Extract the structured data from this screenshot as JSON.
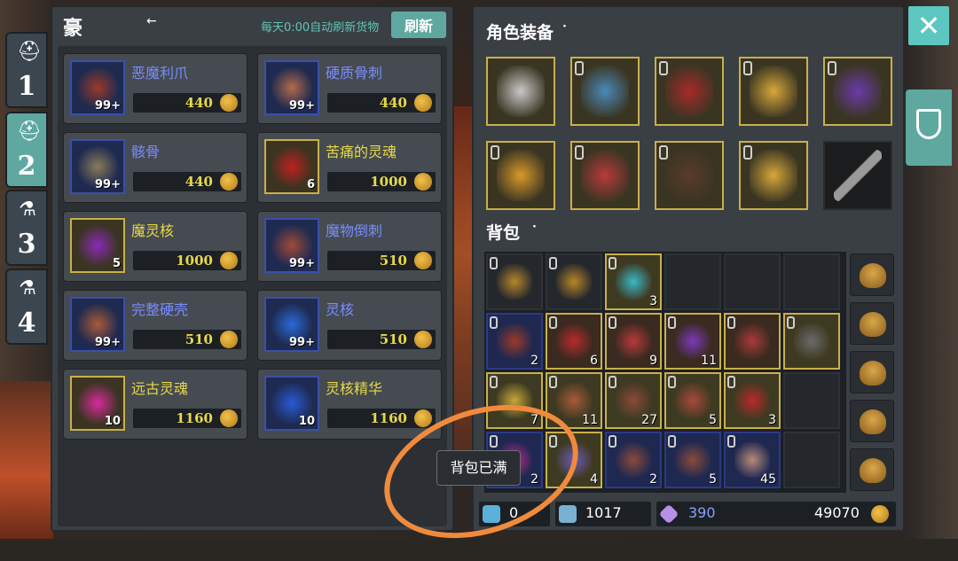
{
  "tabs": [
    {
      "num": "1",
      "icon": "helmet-icon",
      "active": false
    },
    {
      "num": "2",
      "icon": "helmet-icon",
      "active": true
    },
    {
      "num": "3",
      "icon": "potion-icon",
      "active": false
    },
    {
      "num": "4",
      "icon": "potion-icon",
      "active": false
    }
  ],
  "shop": {
    "title": "豪",
    "refresh_note": "每天0:00自动刷新货物",
    "refresh_label": "刷新",
    "items": [
      {
        "name": "恶魔利爪",
        "count": "99+",
        "price": "440",
        "name_color": "#7a8cff",
        "frame": "blue",
        "art": "#9a3a2a"
      },
      {
        "name": "硬质骨刺",
        "count": "99+",
        "price": "440",
        "name_color": "#7a8cff",
        "frame": "blue",
        "art": "#b26a4a"
      },
      {
        "name": "骸骨",
        "count": "99+",
        "price": "440",
        "name_color": "#7a8cff",
        "frame": "blue",
        "art": "#8a7a5a"
      },
      {
        "name": "苦痛的灵魂",
        "count": "6",
        "price": "1000",
        "name_color": "#e8d84a",
        "frame": "gold",
        "art": "#c02020"
      },
      {
        "name": "魔灵核",
        "count": "5",
        "price": "1000",
        "name_color": "#e8d84a",
        "frame": "gold",
        "art": "#8a2ab8"
      },
      {
        "name": "魔物倒刺",
        "count": "99+",
        "price": "510",
        "name_color": "#7a8cff",
        "frame": "blue",
        "art": "#a04a3a"
      },
      {
        "name": "完整硬壳",
        "count": "99+",
        "price": "510",
        "name_color": "#7a8cff",
        "frame": "blue",
        "art": "#a85a3a"
      },
      {
        "name": "灵核",
        "count": "99+",
        "price": "510",
        "name_color": "#7a8cff",
        "frame": "blue",
        "art": "#2a6ad8"
      },
      {
        "name": "远古灵魂",
        "count": "10",
        "price": "1160",
        "name_color": "#e8d84a",
        "frame": "gold",
        "art": "#d82a9a"
      },
      {
        "name": "灵核精华",
        "count": "10",
        "price": "1160",
        "name_color": "#e8d84a",
        "frame": "blue",
        "art": "#2a5ad8"
      }
    ]
  },
  "equip": {
    "title": "角色装备",
    "bag_title": "背包",
    "slots": [
      {
        "art": "#c8c8c8",
        "locked": false
      },
      {
        "art": "#4a8ab8",
        "locked": true
      },
      {
        "art": "#a82a2a",
        "locked": true
      },
      {
        "art": "#d8a83a",
        "locked": true
      },
      {
        "art": "#6a3aa8",
        "locked": true
      },
      {
        "art": "#d89a2a",
        "locked": true
      },
      {
        "art": "#b83a3a",
        "locked": true
      },
      {
        "art": "#5a3a2a",
        "locked": true
      },
      {
        "art": "#d8a83a",
        "locked": true
      },
      {
        "art": "#9a9a9a",
        "locked": false,
        "dark": true
      }
    ],
    "bag": [
      [
        "e:#b8862a:",
        "e:#b8862a:",
        "g:#3ab8c8:3",
        "e::",
        "e::",
        "e::"
      ],
      [
        "b:#9a3a2a:2",
        "r:#b82a2a:6",
        "r:#b83a3a:9",
        "r:#7a3ab8:11",
        "r:#a83a3a:",
        "g:#6a6a6a:"
      ],
      [
        "g:#c8a83a:7",
        "g:#a85a3a:11",
        "g:#8a4a3a:27",
        "g:#a84a3a:5",
        "g:#b82a2a:3",
        "e::"
      ],
      [
        "b:#b82a8a:2",
        "g:#6a5ab8:4",
        "b:#8a4a3a:2",
        "b:#8a4a3a:5",
        "b:#b88a7a:45",
        "e::"
      ]
    ],
    "stats": {
      "wands": "0",
      "wings": "1017",
      "gems": "390",
      "gold": "49070"
    }
  },
  "toast": "背包已满"
}
